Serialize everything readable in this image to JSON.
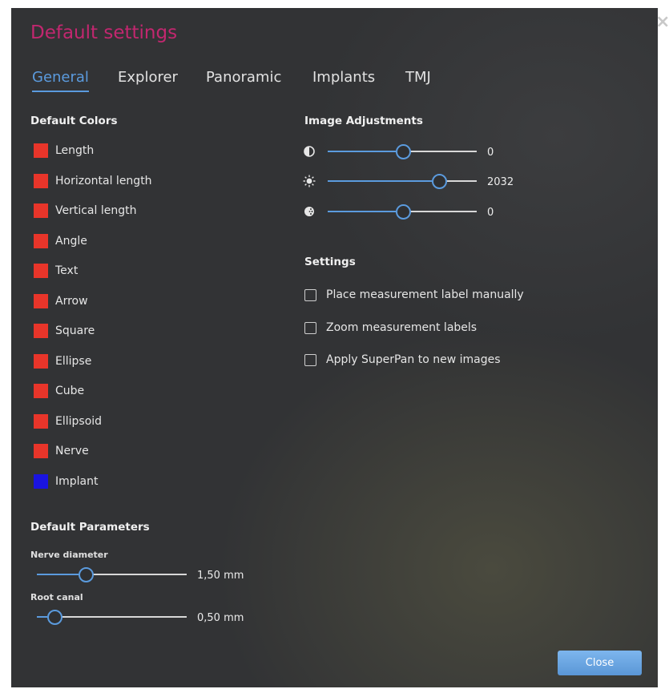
{
  "dialog": {
    "title": "Default settings",
    "close_glyph": "×",
    "close_button_label": "Close",
    "accent_color": "#5b9bde",
    "title_color": "#c2276f"
  },
  "tabs": [
    {
      "label": "General",
      "active": true
    },
    {
      "label": "Explorer",
      "active": false
    },
    {
      "label": "Panoramic",
      "active": false
    },
    {
      "label": "Implants",
      "active": false
    },
    {
      "label": "TMJ",
      "active": false
    }
  ],
  "default_colors": {
    "title": "Default Colors",
    "items": [
      {
        "label": "Length",
        "color": "#e8352a"
      },
      {
        "label": "Horizontal length",
        "color": "#e8352a"
      },
      {
        "label": "Vertical length",
        "color": "#e8352a"
      },
      {
        "label": "Angle",
        "color": "#e8352a"
      },
      {
        "label": "Text",
        "color": "#e8352a"
      },
      {
        "label": "Arrow",
        "color": "#e8352a"
      },
      {
        "label": "Square",
        "color": "#e8352a"
      },
      {
        "label": "Ellipse",
        "color": "#e8352a"
      },
      {
        "label": "Cube",
        "color": "#e8352a"
      },
      {
        "label": "Ellipsoid",
        "color": "#e8352a"
      },
      {
        "label": "Nerve",
        "color": "#e8352a"
      },
      {
        "label": "Implant",
        "color": "#1a14e0"
      }
    ]
  },
  "image_adjustments": {
    "title": "Image Adjustments",
    "sliders": [
      {
        "icon": "contrast-icon",
        "value": "0",
        "level": 0.5
      },
      {
        "icon": "brightness-icon",
        "value": "2032",
        "level": 0.74
      },
      {
        "icon": "gamma-icon",
        "value": "0",
        "level": 0.5
      }
    ]
  },
  "settings": {
    "title": "Settings",
    "options": [
      {
        "label": "Place measurement label manually",
        "checked": false
      },
      {
        "label": "Zoom measurement labels",
        "checked": false
      },
      {
        "label": "Apply SuperPan to new images",
        "checked": false
      }
    ]
  },
  "default_parameters": {
    "title": "Default Parameters",
    "params": [
      {
        "label": "Nerve diameter",
        "value": "1,50 mm",
        "level": 0.32
      },
      {
        "label": "Root canal",
        "value": "0,50 mm",
        "level": 0.11
      }
    ]
  }
}
